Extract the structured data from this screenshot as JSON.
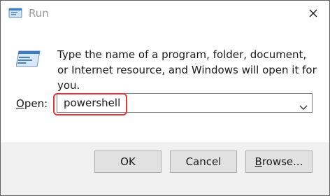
{
  "window": {
    "title": "Run",
    "title_icon": "run-icon",
    "close_icon": "close-icon"
  },
  "content": {
    "icon": "run-icon",
    "description": "Type the name of a program, folder, document, or Internet resource, and Windows will open it for you."
  },
  "open_field": {
    "label_underlined": "O",
    "label_rest": "pen:",
    "value": "powershell",
    "dropdown_icon": "chevron-down-icon",
    "highlight_color": "#e8363b"
  },
  "buttons": {
    "ok": "OK",
    "cancel": "Cancel",
    "browse_underlined": "B",
    "browse_rest": "rowse..."
  }
}
